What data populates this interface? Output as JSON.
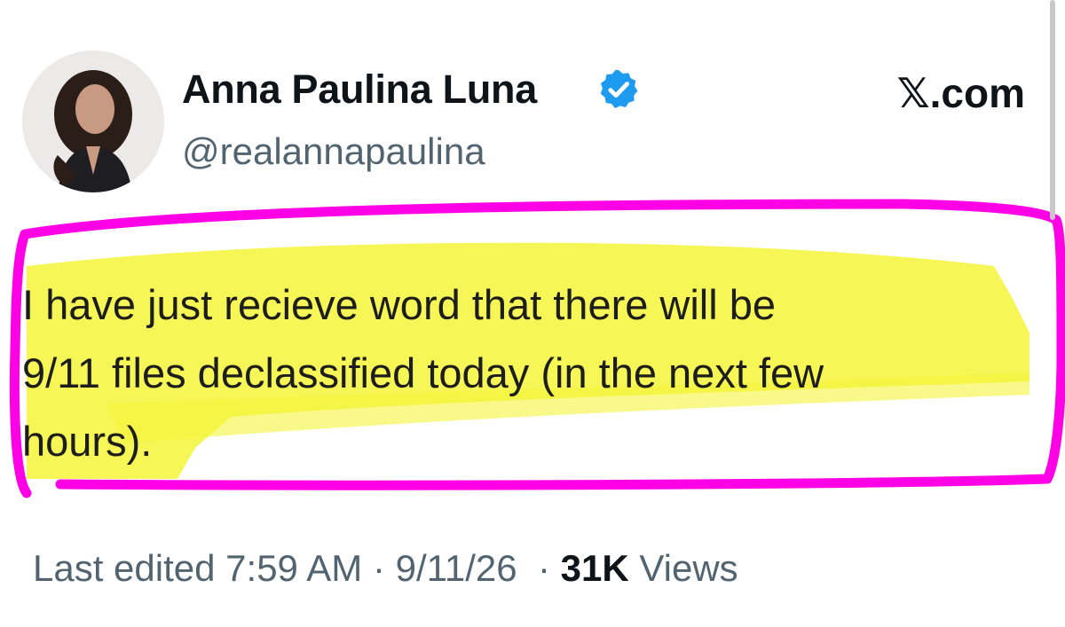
{
  "author": {
    "display_name": "Anna Paulina Luna",
    "handle": "@realannapaulina",
    "verified": true,
    "verified_icon": "verified-badge-icon",
    "verified_color": "#1d9bf0"
  },
  "brand": {
    "label": "𝕏.com"
  },
  "tweet": {
    "text": "I have just recieve word that there will be\n9/11 files declassified today (in the next few\nhours)."
  },
  "meta": {
    "edited_label": "Last edited",
    "time": "7:59 AM",
    "separator": "·",
    "date": "9/11/26",
    "views_count": "31K",
    "views_label": "Views"
  },
  "annotation": {
    "highlight_color": "#f5f53a",
    "outline_color": "#ff00e6"
  }
}
